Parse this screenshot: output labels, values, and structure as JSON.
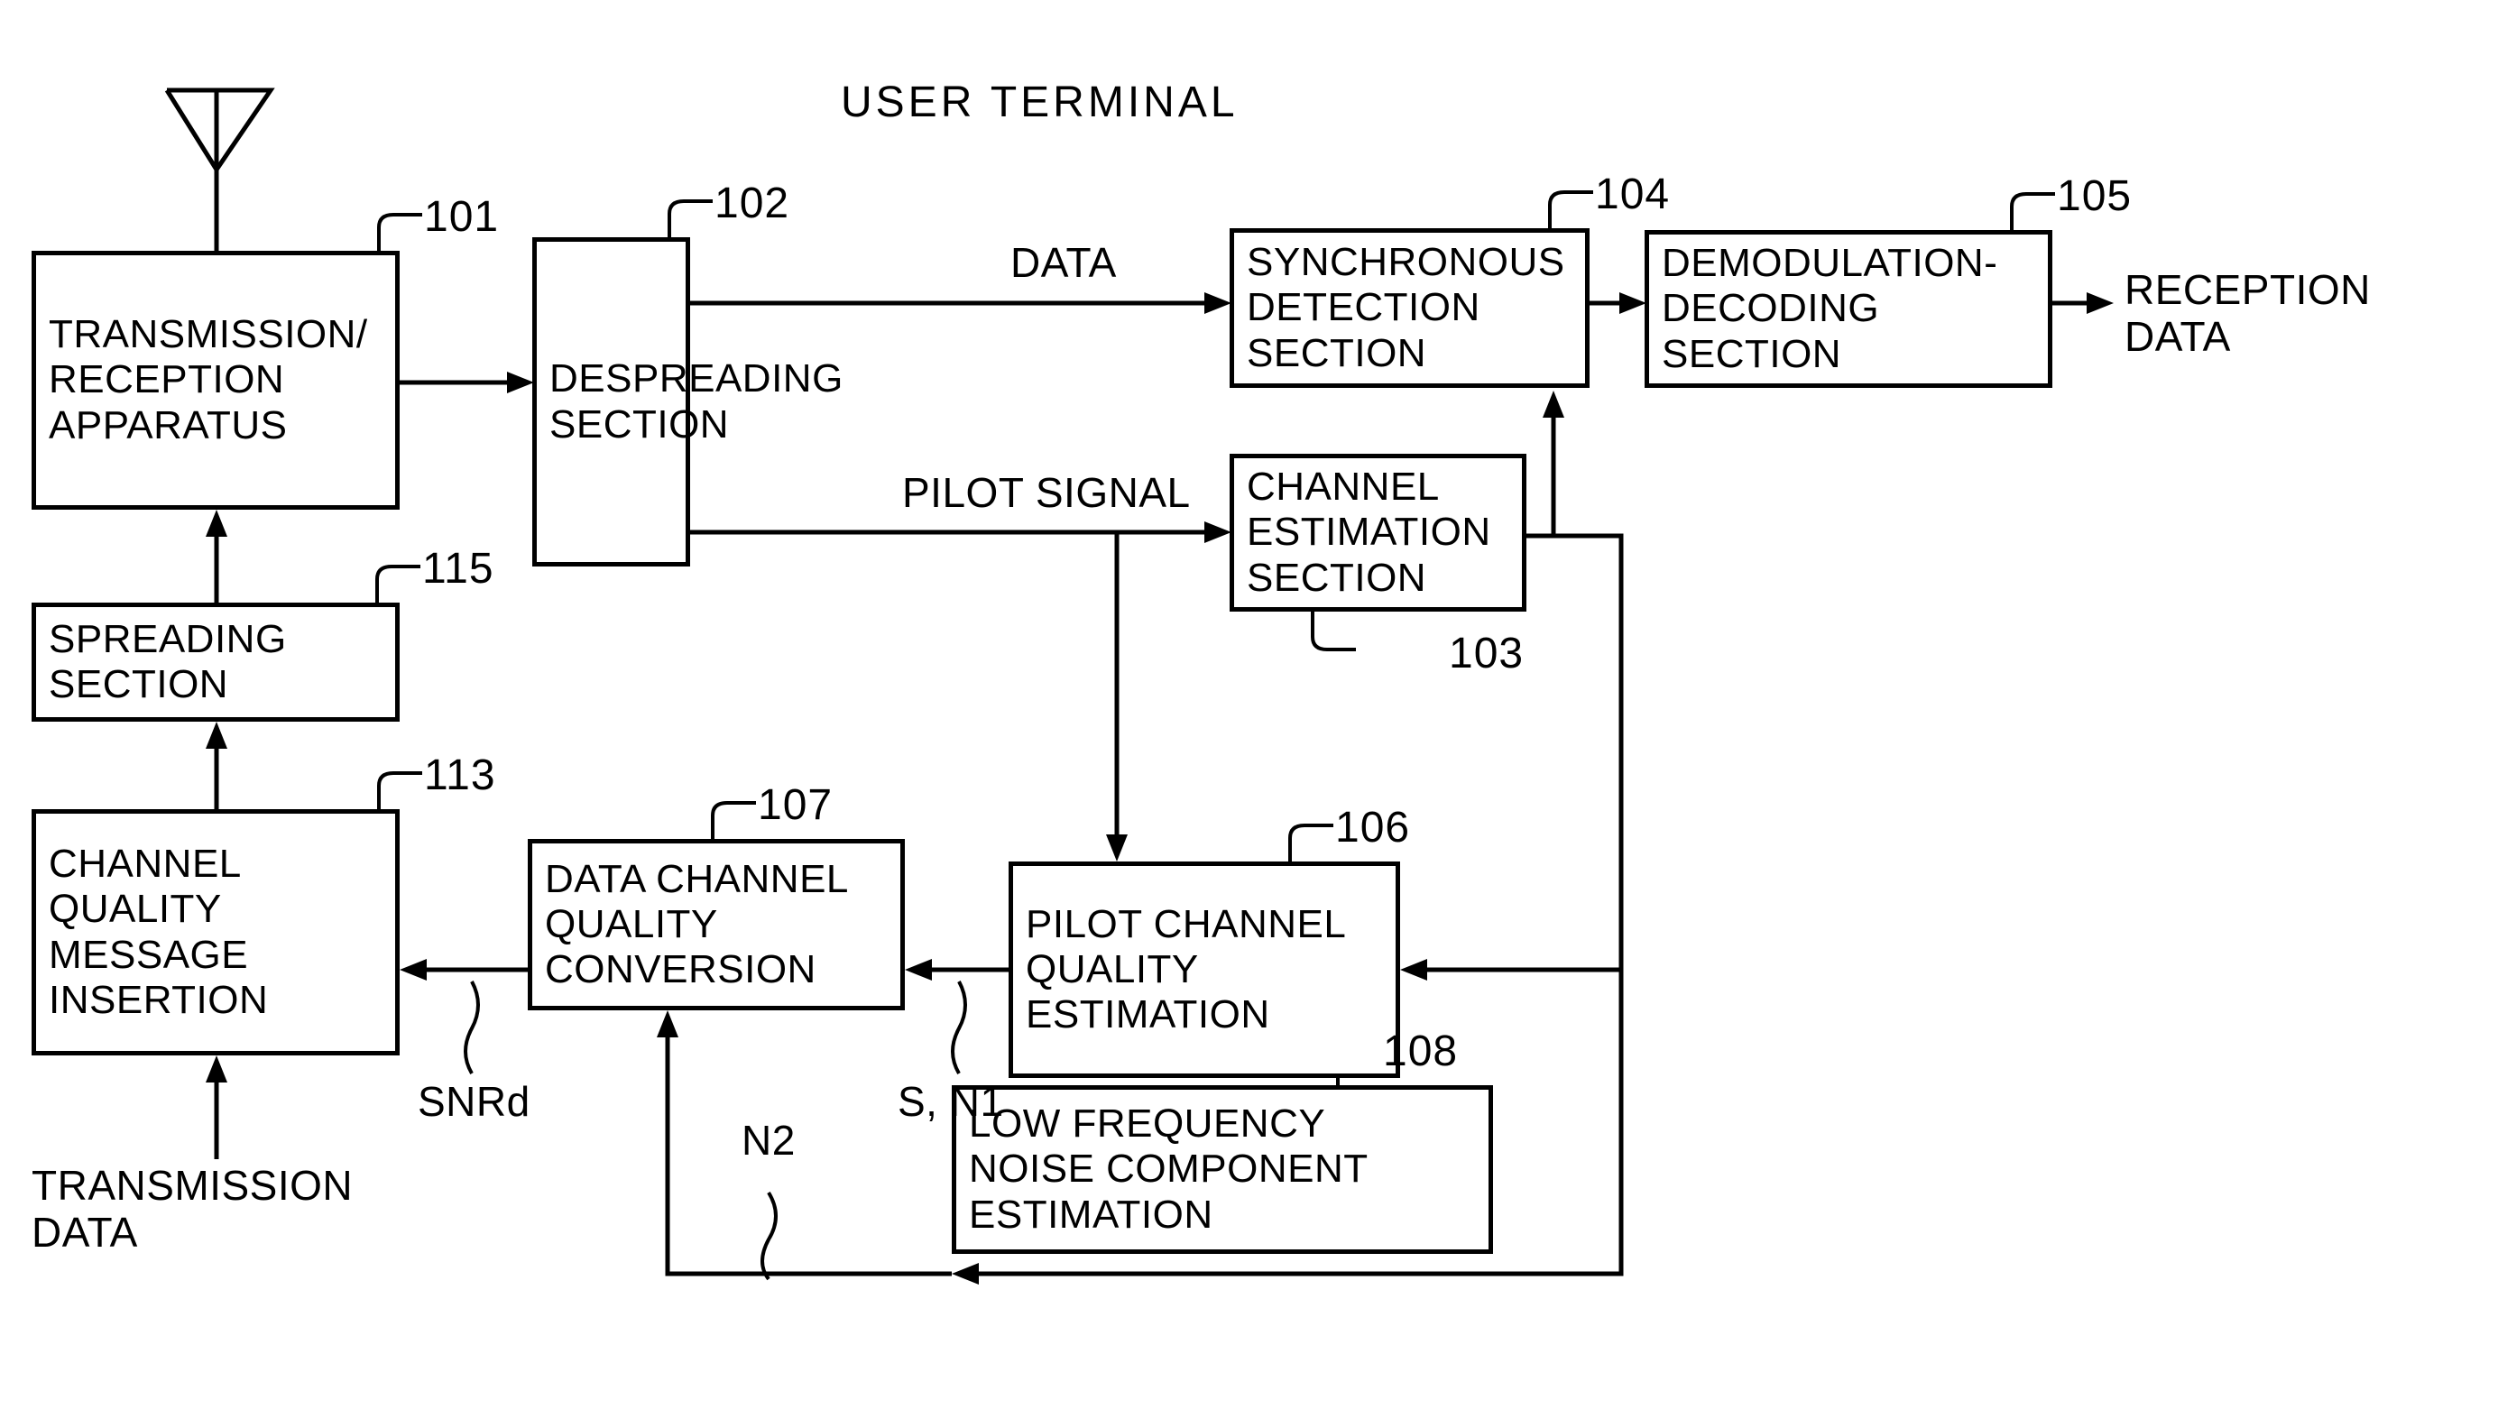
{
  "diagram": {
    "title": "USER TERMINAL",
    "boxes": [
      {
        "ref": "101",
        "label": "TRANSMISSION/\nRECEPTION\nAPPARATUS"
      },
      {
        "ref": "102",
        "label": "DESPREADING\nSECTION"
      },
      {
        "ref": "104",
        "label": "SYNCHRONOUS\nDETECTION\nSECTION"
      },
      {
        "ref": "105",
        "label": "DEMODULATION-\nDECODING\nSECTION"
      },
      {
        "ref": "103",
        "label": "CHANNEL\nESTIMATION\nSECTION"
      },
      {
        "ref": "115",
        "label": "SPREADING\nSECTION"
      },
      {
        "ref": "113",
        "label": "CHANNEL\nQUALITY\nMESSAGE\nINSERTION"
      },
      {
        "ref": "107",
        "label": "DATA CHANNEL\nQUALITY\nCONVERSION"
      },
      {
        "ref": "106",
        "label": "PILOT CHANNEL\nQUALITY\nESTIMATION"
      },
      {
        "ref": "108",
        "label": "LOW FREQUENCY\nNOISE COMPONENT\nESTIMATION"
      }
    ],
    "signals": {
      "data": "DATA",
      "pilot_signal": "PILOT SIGNAL",
      "reception_data": "RECEPTION\nDATA",
      "transmission_data": "TRANSMISSION\nDATA",
      "snrd": "SNRd",
      "s_n1": "S, N1",
      "n2": "N2"
    },
    "icons": {
      "antenna": "antenna-icon"
    },
    "colors": {
      "line": "#000000",
      "background": "#ffffff"
    }
  }
}
